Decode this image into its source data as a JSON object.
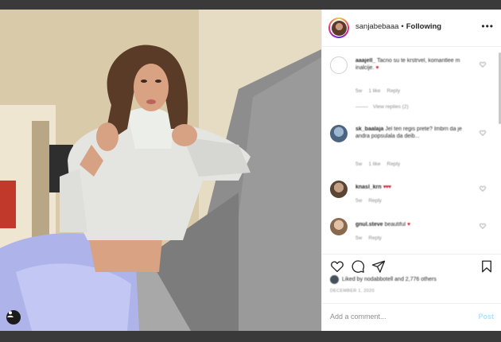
{
  "post": {
    "username": "sanjabebaaa",
    "separator": "•",
    "follow_status": "Following",
    "more_icon": "more-horizontal-icon"
  },
  "comments": [
    {
      "user": "aaajell_",
      "text": "Tacno su te krstrvel, komantlee m inalcije.",
      "time": "5w",
      "likes": "1 like",
      "reply": "Reply",
      "view_replies": "View replies (2)",
      "avatar": "outline"
    },
    {
      "user": "sk_baalaja",
      "text": "Jel teri regis prete? Imbrn da je andra popsulala da deib...",
      "time": "5w",
      "likes": "1 like",
      "reply": "Reply",
      "avatar": "photo-blue"
    },
    {
      "user": "knasl_krn",
      "text": "",
      "time": "5w",
      "reply": "Reply",
      "avatar": "photo-brown"
    },
    {
      "user": "gnul.steve",
      "text": "beautiful",
      "time": "5w",
      "reply": "Reply",
      "avatar": "photo-tan"
    }
  ],
  "likes_text": "Liked by nodabbotell and 2,776 others",
  "date_text": "DECEMBER 1, 2020",
  "add_comment": {
    "placeholder": "Add a comment...",
    "post_label": "Post"
  },
  "colors": {
    "heart_red": "#d2243b",
    "post_link": "#b2dffc",
    "text": "#262626",
    "muted": "#8e8e8e"
  }
}
